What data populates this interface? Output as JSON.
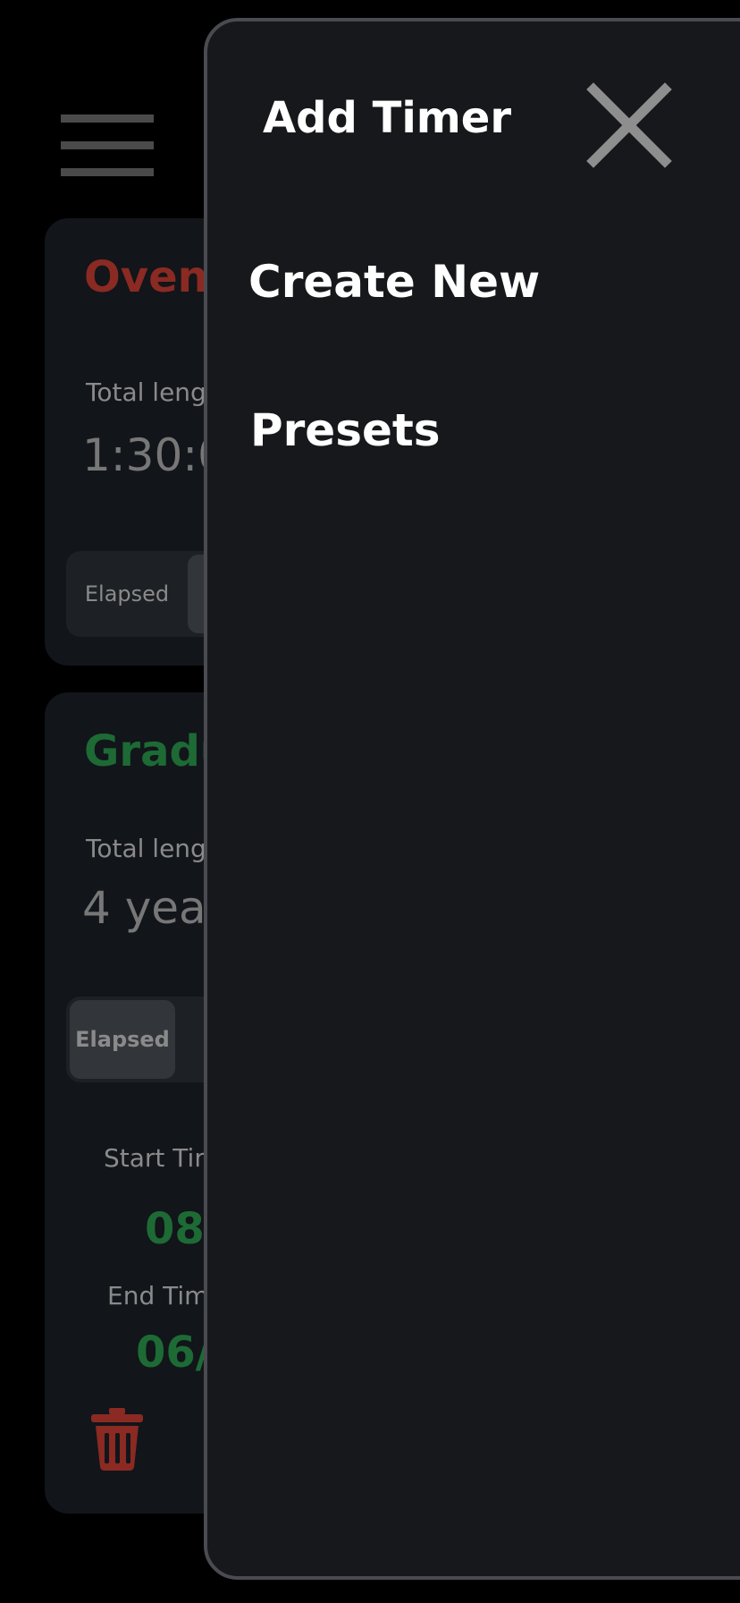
{
  "colors": {
    "red_accent": "#8a2a22",
    "green_accent": "#1d6a35",
    "drawer_bg": "#17181b",
    "card_bg": "#12151a"
  },
  "background": {
    "menu_icon": "hamburger-icon",
    "timers": [
      {
        "title": "Oven",
        "total_length_label": "Total leng",
        "total_length_value": "1:30:0",
        "segment_labels": [
          "Elapsed",
          ""
        ]
      },
      {
        "title": "Gradu",
        "total_length_label": "Total leng",
        "total_length_value": "4 year",
        "segment_labels": [
          "Elapsed",
          ""
        ],
        "start_time_label": "Start Tin",
        "start_time_value": "08",
        "end_time_label": "End Tim",
        "end_time_value": "06/",
        "delete_icon": "trash-icon"
      }
    ]
  },
  "drawer": {
    "title": "Add Timer",
    "close_icon": "close-icon",
    "items": [
      {
        "label": "Create New"
      },
      {
        "label": "Presets"
      }
    ]
  }
}
